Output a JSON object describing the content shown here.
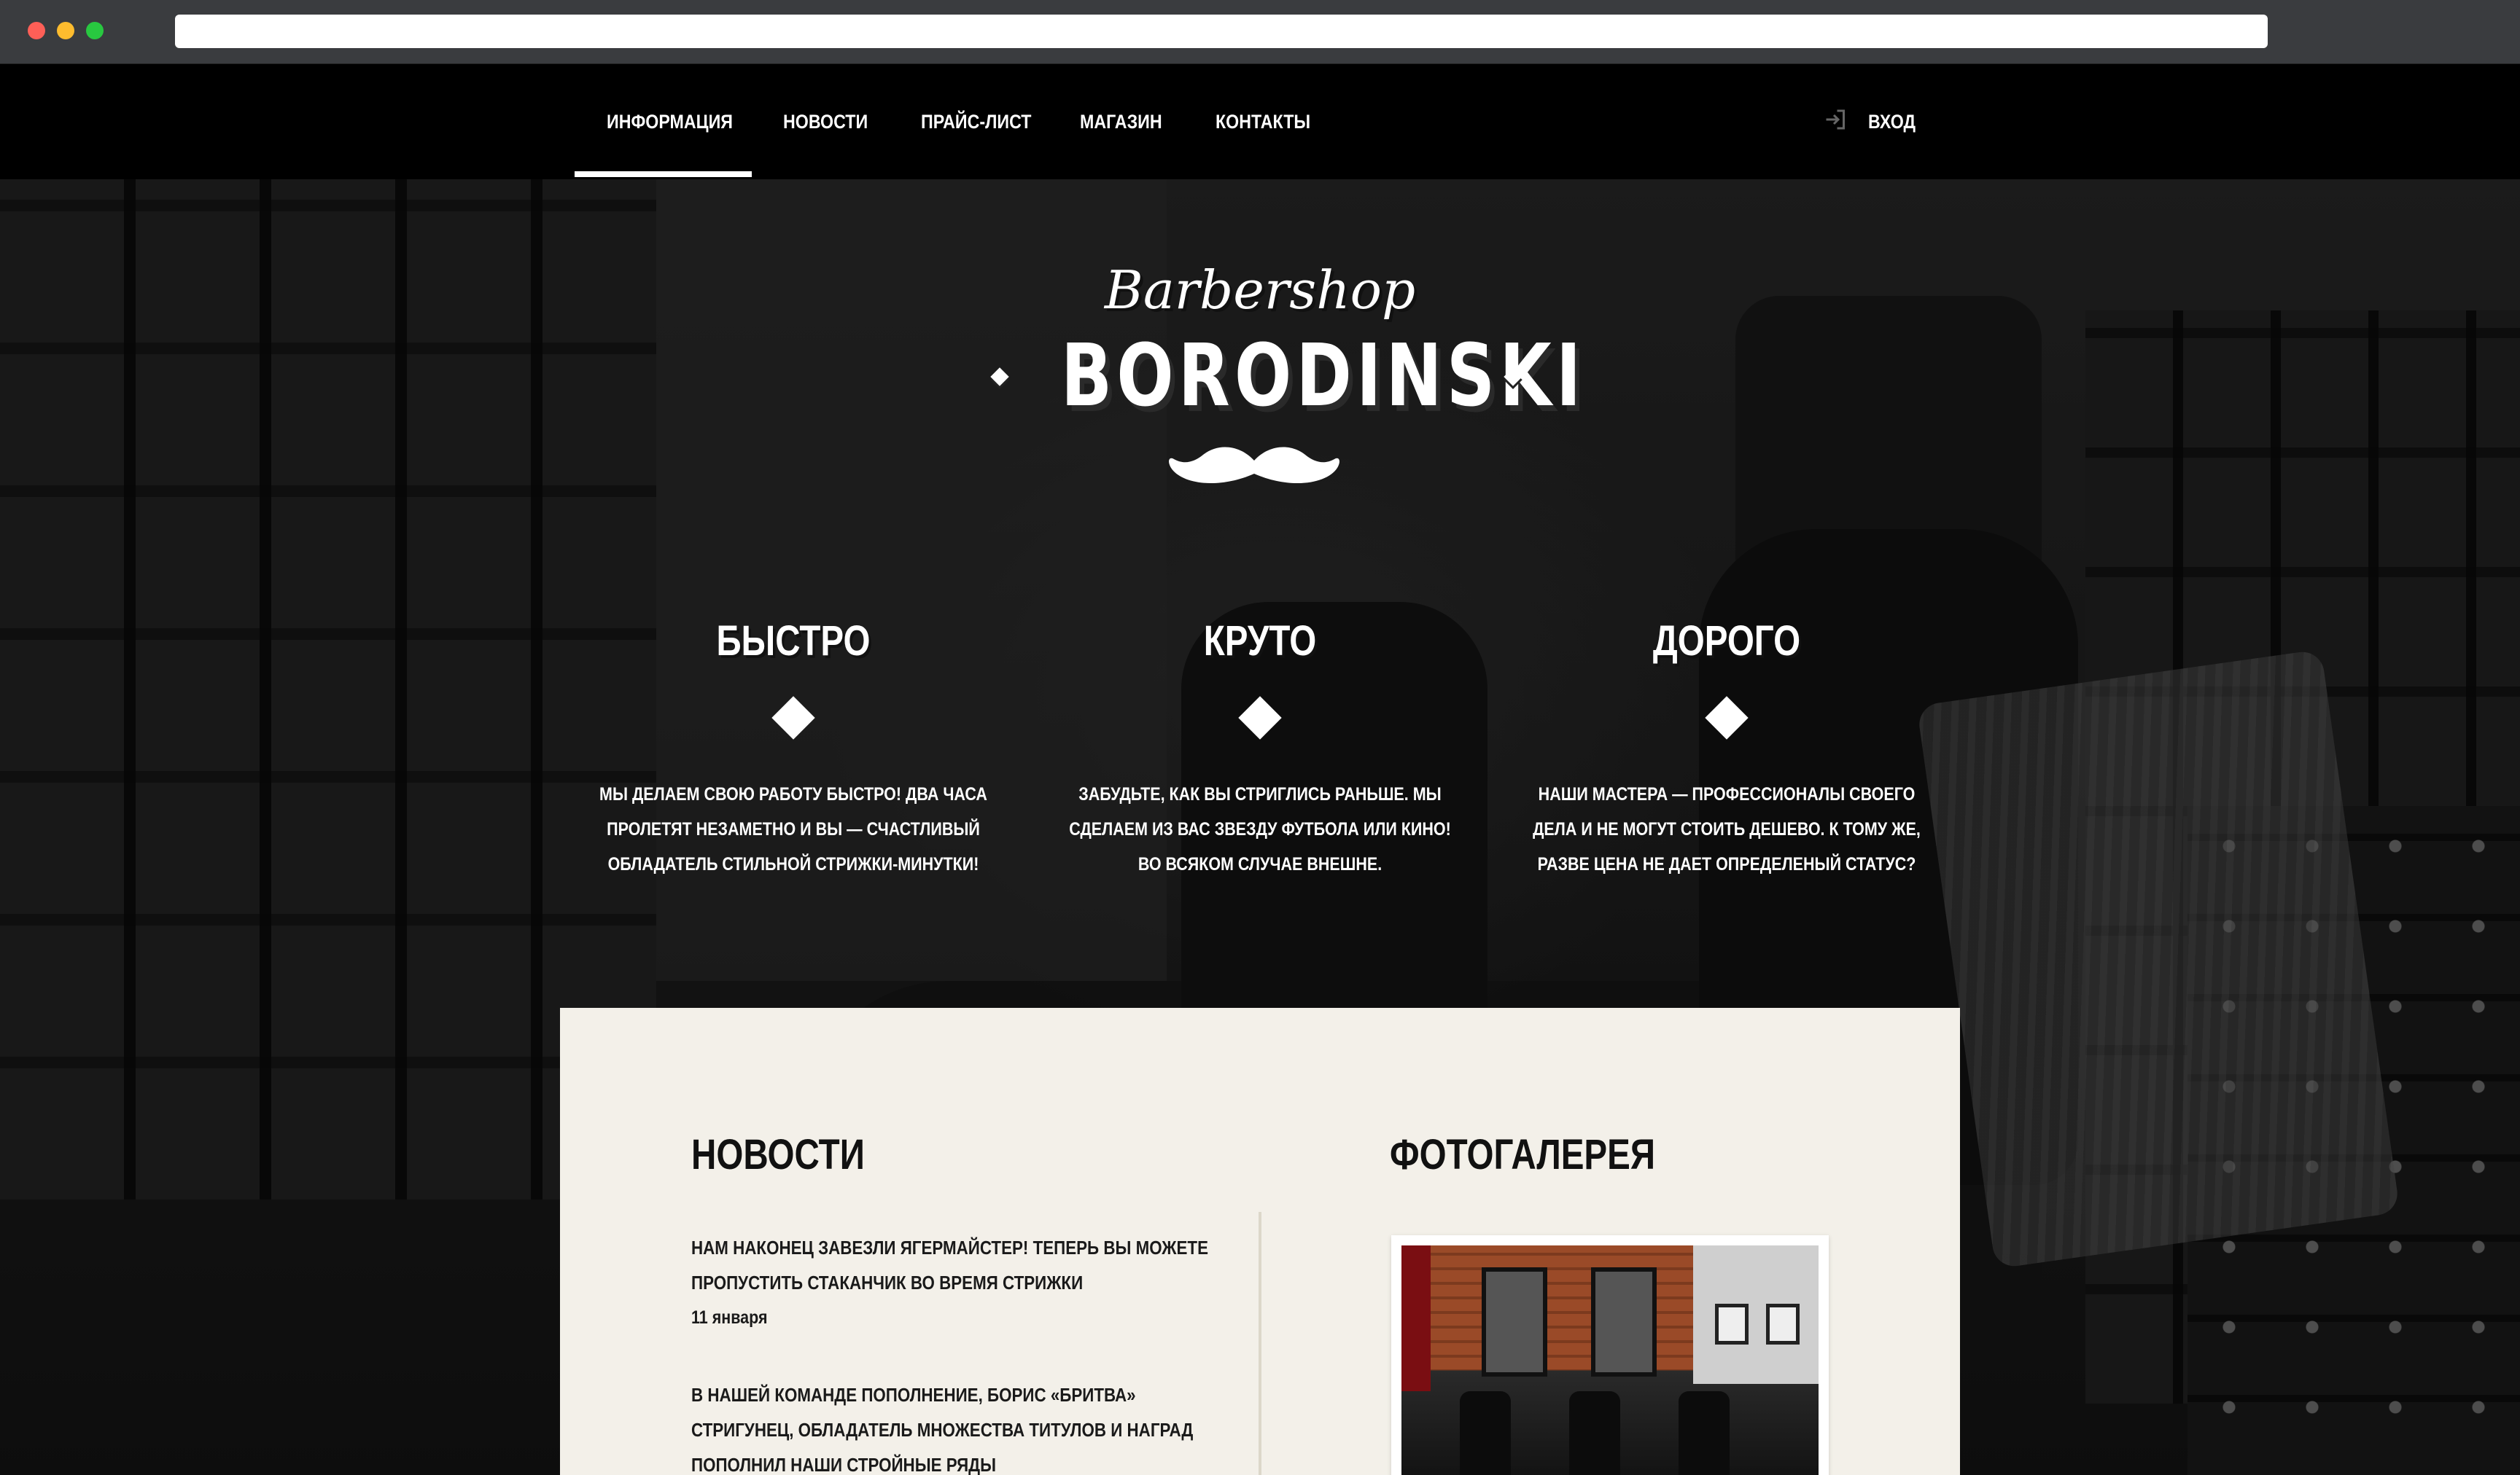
{
  "browser": {
    "address": ""
  },
  "nav": {
    "items": [
      "ИНФОРМАЦИЯ",
      "НОВОСТИ",
      "ПРАЙС-ЛИСТ",
      "МАГАЗИН",
      "КОНТАКТЫ"
    ],
    "active_index": 0,
    "login_label": "ВХОД"
  },
  "logo": {
    "script": "Barbershop",
    "name": "BORODINSKI"
  },
  "features": [
    {
      "title": "БЫСТРО",
      "text": "МЫ ДЕЛАЕМ СВОЮ РАБОТУ БЫСТРО! ДВА ЧАСА ПРОЛЕТЯТ НЕЗАМЕТНО И ВЫ — СЧАСТЛИВЫЙ ОБЛАДАТЕЛЬ СТИЛЬНОЙ СТРИЖКИ-МИНУТКИ!"
    },
    {
      "title": "КРУТО",
      "text": "ЗАБУДЬТЕ, КАК ВЫ СТРИГЛИСЬ РАНЬШЕ. МЫ СДЕЛАЕМ ИЗ ВАС ЗВЕЗДУ ФУТБОЛА ИЛИ КИНО! ВО ВСЯКОМ СЛУЧАЕ ВНЕШНЕ."
    },
    {
      "title": "ДОРОГО",
      "text": "НАШИ МАСТЕРА — ПРОФЕССИОНАЛЫ СВОЕГО ДЕЛА И НЕ МОГУТ СТОИТЬ ДЕШЕВО. К ТОМУ ЖЕ, РАЗВЕ ЦЕНА НЕ ДАЕТ ОПРЕДЕЛЕНЫЙ СТАТУС?"
    }
  ],
  "news": {
    "title": "НОВОСТИ",
    "items": [
      {
        "text": "НАМ НАКОНЕЦ ЗАВЕЗЛИ ЯГЕРМАЙСТЕР! ТЕПЕРЬ ВЫ МОЖЕТЕ ПРОПУСТИТЬ СТАКАНЧИК ВО ВРЕМЯ СТРИЖКИ",
        "date": "11 января"
      },
      {
        "text": "В НАШЕЙ КОМАНДЕ ПОПОЛНЕНИЕ, БОРИС «БРИТВА» СТРИГУНЕЦ, ОБЛАДАТЕЛЬ МНОЖЕСТВА ТИТУЛОВ И НАГРАД ПОПОЛНИЛ НАШИ СТРОЙНЫЕ РЯДЫ",
        "date": ""
      }
    ]
  },
  "gallery": {
    "title": "ФОТОГАЛЕРЕЯ"
  },
  "colors": {
    "nav_bg": "#000000",
    "panel_bg": "#f3f0e9",
    "text_light": "#ffffff",
    "text_dark": "#111111"
  }
}
